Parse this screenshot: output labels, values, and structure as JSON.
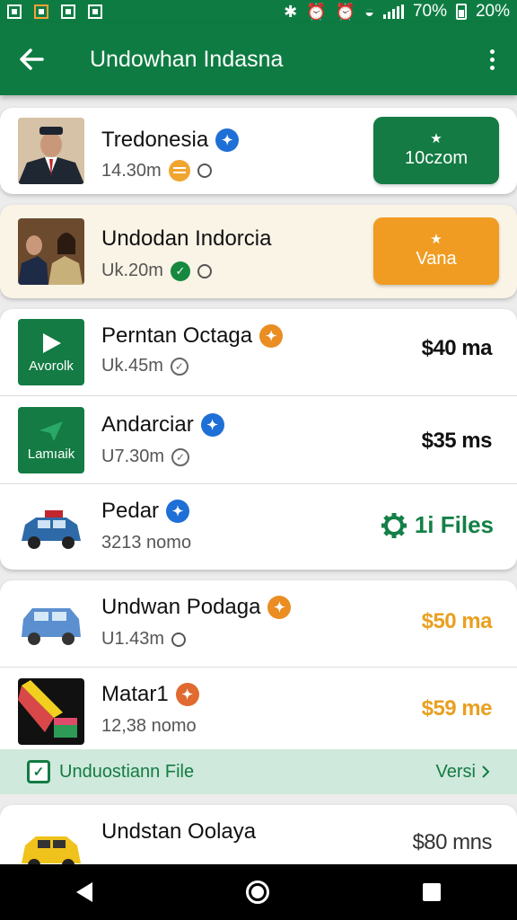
{
  "status_bar": {
    "wifi_percent": "70%",
    "battery_percent": "20%"
  },
  "app_bar": {
    "title": "Undowhan Indasna"
  },
  "items": [
    {
      "name": "Tredonesia",
      "sub": "14.30m",
      "action_label": "10czom"
    },
    {
      "name": "Undodan Indorcia",
      "sub": "Uk.20m",
      "action_label": "Vana"
    },
    {
      "name": "Perntan Octaga",
      "sub": "Uk.45m",
      "thumb_text": "Avorolk",
      "price": "$40 ma"
    },
    {
      "name": "Andarciar",
      "sub": "U7.30m",
      "thumb_text": "Lamıaik",
      "price": "$35 ms"
    },
    {
      "name": "Pedar",
      "sub": "3213 nomo",
      "files_label": "1i Files"
    },
    {
      "name": "Undwan Podaga",
      "sub": "U1.43m",
      "price": "$50 ma"
    },
    {
      "name": "Matar1",
      "sub": "12,38 nomo",
      "price": "$59 me"
    },
    {
      "name": "Undstan Oolaya",
      "price": "$80 mns"
    }
  ],
  "banner": {
    "text": "Unduostiann File",
    "link": "Versi"
  },
  "icons": {
    "back": "arrow-left-icon",
    "menu": "more-vert-icon",
    "verified": "verified-badge-icon",
    "gear": "gear-icon"
  },
  "colors": {
    "primary": "#0e7c42",
    "accent": "#f09c22",
    "verified_blue": "#1e6fd6"
  }
}
